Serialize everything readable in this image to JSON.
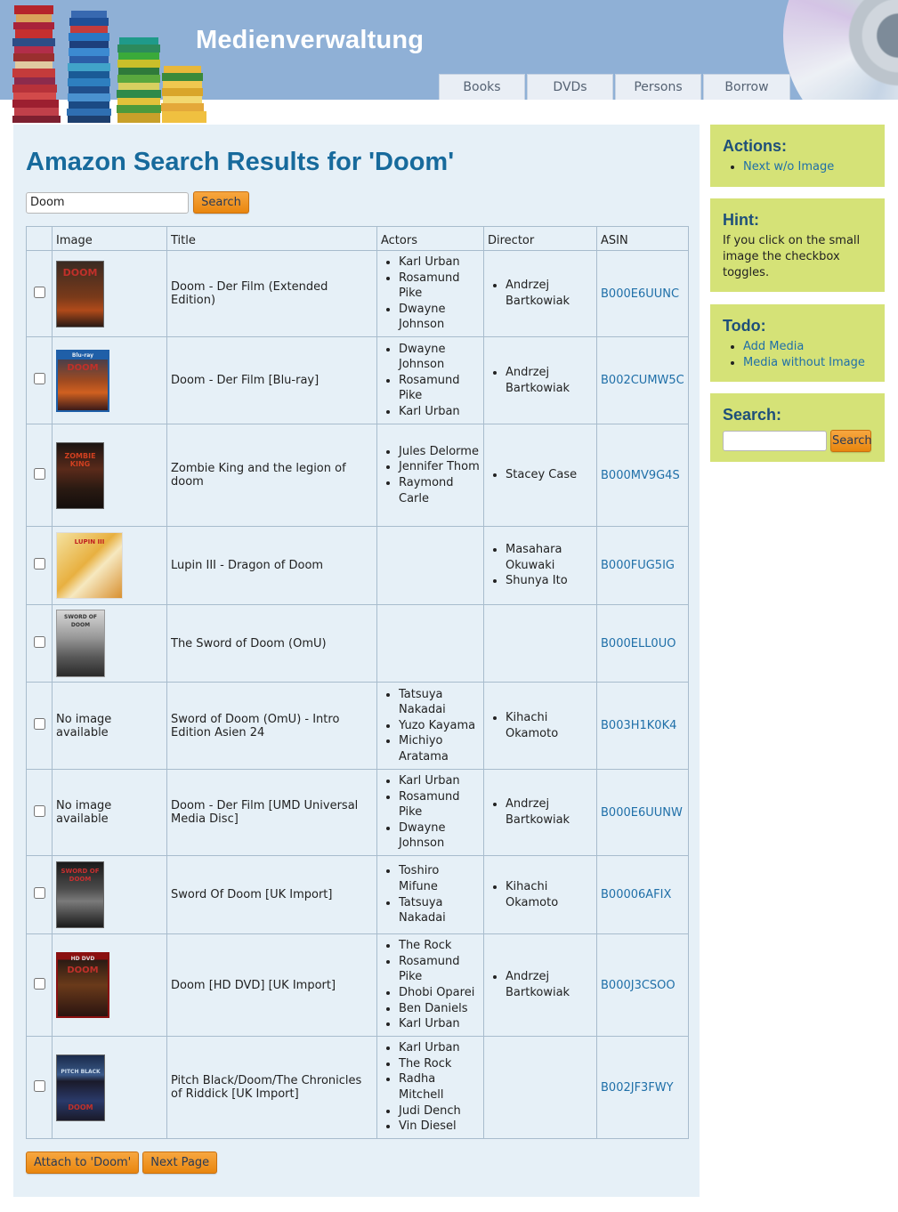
{
  "site": {
    "title": "Medienverwaltung"
  },
  "nav": {
    "tabs": [
      {
        "label": "Books"
      },
      {
        "label": "DVDs"
      },
      {
        "label": "Persons"
      },
      {
        "label": "Borrow"
      }
    ]
  },
  "main": {
    "title": "Amazon Search Results for 'Doom'",
    "search": {
      "value": "Doom",
      "button": "Search"
    },
    "columns": [
      "",
      "Image",
      "Title",
      "Actors",
      "Director",
      "ASIN"
    ],
    "no_image_text": "No image available",
    "rows": [
      {
        "title": "Doom - Der Film (Extended Edition)",
        "actors": [
          "Karl Urban",
          "Rosamund Pike",
          "Dwayne Johnson"
        ],
        "directors": [
          "Andrzej Bartkowiak"
        ],
        "asin": "B000E6UUNC",
        "image": "doom-extended-cover"
      },
      {
        "title": "Doom - Der Film [Blu-ray]",
        "actors": [
          "Dwayne Johnson",
          "Rosamund Pike",
          "Karl Urban"
        ],
        "directors": [
          "Andrzej Bartkowiak"
        ],
        "asin": "B002CUMW5C",
        "image": "doom-bluray-cover"
      },
      {
        "title": "Zombie King and the legion of doom",
        "actors": [
          "Jules Delorme",
          "Jennifer Thom",
          "Raymond Carle"
        ],
        "directors": [
          "Stacey Case"
        ],
        "asin": "B000MV9G4S",
        "image": "zombie-king-cover"
      },
      {
        "title": "Lupin III - Dragon of Doom",
        "actors": [],
        "directors": [
          "Masahara Okuwaki",
          "Shunya Ito"
        ],
        "asin": "B000FUG5IG",
        "image": "lupin-cover"
      },
      {
        "title": "The Sword of Doom (OmU)",
        "actors": [],
        "directors": [],
        "asin": "B000ELL0UO",
        "image": "sword-of-doom-cover"
      },
      {
        "title": "Sword of Doom (OmU) - Intro Edition Asien 24",
        "actors": [
          "Tatsuya Nakadai",
          "Yuzo Kayama",
          "Michiyo Aratama"
        ],
        "directors": [
          "Kihachi Okamoto"
        ],
        "asin": "B003H1K0K4",
        "image": ""
      },
      {
        "title": "Doom - Der Film [UMD Universal Media Disc]",
        "actors": [
          "Karl Urban",
          "Rosamund Pike",
          "Dwayne Johnson"
        ],
        "directors": [
          "Andrzej Bartkowiak"
        ],
        "asin": "B000E6UUNW",
        "image": ""
      },
      {
        "title": "Sword Of Doom [UK Import]",
        "actors": [
          "Toshiro Mifune",
          "Tatsuya Nakadai"
        ],
        "directors": [
          "Kihachi Okamoto"
        ],
        "asin": "B00006AFIX",
        "image": "sword-of-doom-uk-cover"
      },
      {
        "title": "Doom [HD DVD] [UK Import]",
        "actors": [
          "The Rock",
          "Rosamund Pike",
          "Dhobi Oparei",
          "Ben Daniels",
          "Karl Urban"
        ],
        "directors": [
          "Andrzej Bartkowiak"
        ],
        "asin": "B000J3CSOO",
        "image": "doom-hddvd-cover"
      },
      {
        "title": "Pitch Black/Doom/The Chronicles of Riddick [UK Import]",
        "actors": [
          "Karl Urban",
          "The Rock",
          "Radha Mitchell",
          "Judi Dench",
          "Vin Diesel"
        ],
        "directors": [],
        "asin": "B002JF3FWY",
        "image": "pitch-black-doom-riddick-cover"
      }
    ],
    "buttons": {
      "attach": "Attach to 'Doom'",
      "next": "Next Page"
    }
  },
  "sidebar": {
    "actions": {
      "title": "Actions:",
      "links": [
        "Next w/o Image"
      ]
    },
    "hint": {
      "title": "Hint:",
      "text": "If you click on the small image the checkbox toggles."
    },
    "todo": {
      "title": "Todo:",
      "links": [
        "Add Media",
        "Media without Image"
      ]
    },
    "search": {
      "title": "Search:",
      "value": "",
      "button": "Search"
    }
  },
  "colors": {
    "header_bg": "#8fb0d6",
    "title_blue": "#176a9c",
    "content_bg": "#e6f0f7",
    "sidebar_bg": "#d5e277",
    "button_orange": "#f09a28",
    "link_blue": "#1f6fa8"
  }
}
